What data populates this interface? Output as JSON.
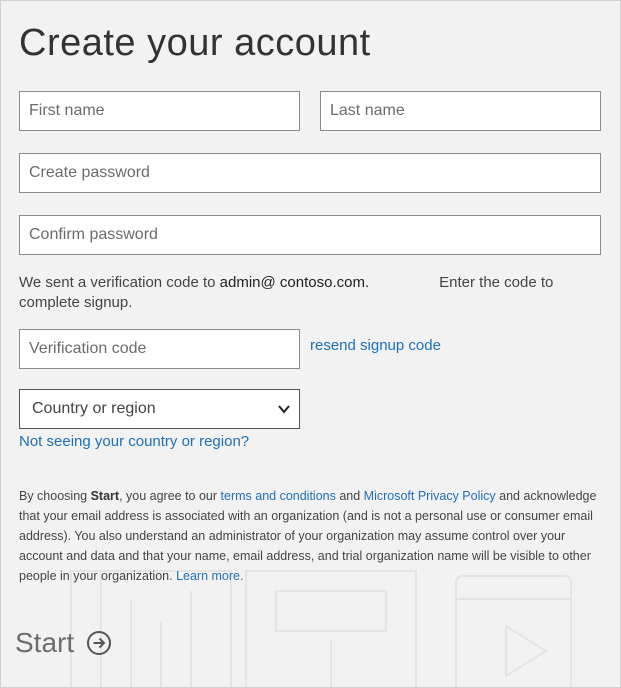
{
  "title": "Create your account",
  "form": {
    "first_name_placeholder": "First name",
    "last_name_placeholder": "Last name",
    "create_password_placeholder": "Create password",
    "confirm_password_placeholder": "Confirm password",
    "verification_code_placeholder": "Verification code",
    "country_select_value": "Country or region"
  },
  "verification": {
    "text_before": "We sent a verification code to ",
    "email": "admin@ contoso.com.",
    "text_after": "Enter the code to complete signup."
  },
  "links": {
    "resend": "resend signup code",
    "not_seeing_country": "Not seeing your country or region?",
    "terms": "terms and conditions",
    "privacy": "Microsoft Privacy Policy",
    "learn_more": "Learn more."
  },
  "legal": {
    "part1": "By choosing ",
    "start_word": "Start",
    "part2": ", you agree to our ",
    "part3": " and ",
    "part4": " and acknowledge that your email address is associated with an organization (and is not a personal use or consumer email address). You also understand an administrator of your organization may assume control over your account and data and that your name, email address, and trial organization name will be visible to other people in your organization. "
  },
  "start_button": {
    "label": "Start",
    "icon": "arrow-circle-right-icon"
  },
  "colors": {
    "background": "#f2f2f2",
    "link": "#1f6fb5",
    "start_text": "#6d6d6d"
  }
}
